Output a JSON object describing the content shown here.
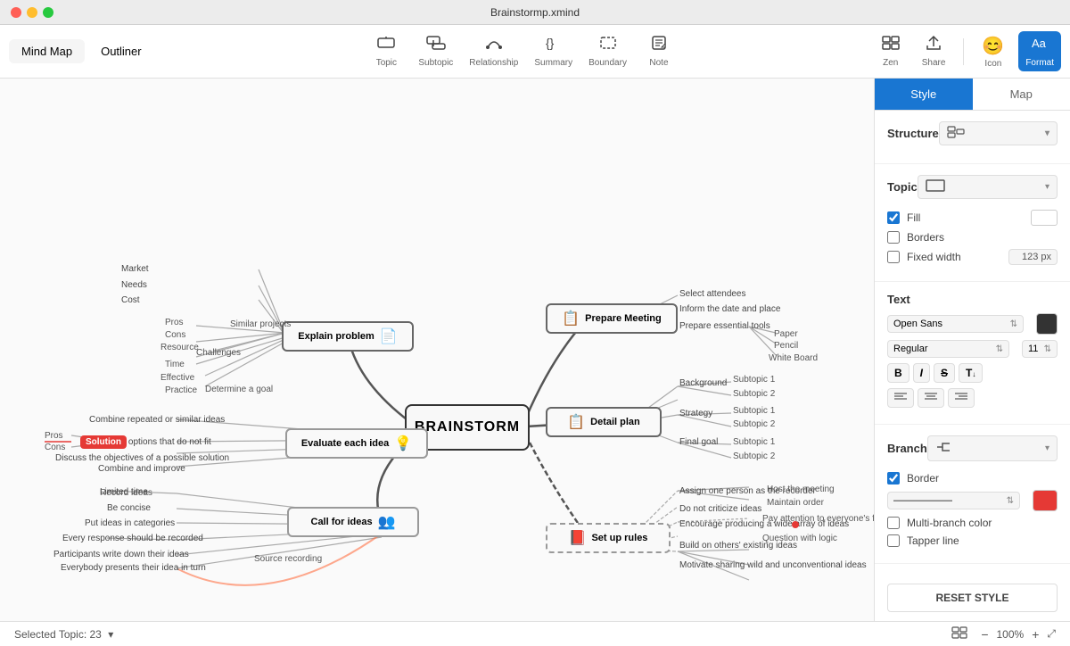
{
  "window": {
    "title": "Brainstormp.xmind"
  },
  "toolbar": {
    "tabs": [
      {
        "id": "mindmap",
        "label": "Mind Map",
        "active": true
      },
      {
        "id": "outliner",
        "label": "Outliner",
        "active": false
      }
    ],
    "tools": [
      {
        "id": "topic",
        "label": "Topic",
        "icon": "⊞"
      },
      {
        "id": "subtopic",
        "label": "Subtopic",
        "icon": "⊟"
      },
      {
        "id": "relationship",
        "label": "Relationship",
        "icon": "↩"
      },
      {
        "id": "summary",
        "label": "Summary",
        "icon": "{}"
      },
      {
        "id": "boundary",
        "label": "Boundary",
        "icon": "⬚"
      },
      {
        "id": "note",
        "label": "Note",
        "icon": "✎"
      }
    ],
    "actions": [
      {
        "id": "zen",
        "label": "Zen",
        "icon": "⛶"
      },
      {
        "id": "share",
        "label": "Share",
        "icon": "⬆"
      }
    ],
    "right_actions": [
      {
        "id": "icon",
        "label": "Icon"
      },
      {
        "id": "format",
        "label": "Format"
      }
    ]
  },
  "status_bar": {
    "selected": "Selected Topic: 23",
    "zoom": "100%",
    "zoom_minus": "−",
    "zoom_plus": "+"
  },
  "right_panel": {
    "tabs": [
      {
        "id": "style",
        "label": "Style",
        "active": true
      },
      {
        "id": "map",
        "label": "Map",
        "active": false
      }
    ],
    "structure": {
      "label": "Structure",
      "value": "Mind Map",
      "icon": "⊟⊟"
    },
    "topic": {
      "label": "Topic",
      "shape": "Rectangle",
      "fill_checked": true,
      "fill_label": "Fill",
      "borders_checked": false,
      "borders_label": "Borders",
      "fixed_width_checked": false,
      "fixed_width_label": "Fixed width",
      "fixed_width_value": "123 px"
    },
    "text": {
      "label": "Text",
      "font": "Open Sans",
      "weight": "Regular",
      "size": "11",
      "color": "#333333",
      "bold": "B",
      "italic": "I",
      "strikethrough": "S",
      "more": "T↓",
      "align_left": "≡",
      "align_center": "≡",
      "align_right": "≡"
    },
    "branch": {
      "label": "Branch",
      "style": "L-shape",
      "border_checked": true,
      "border_label": "Border",
      "line_style": "—————",
      "color": "#e53935",
      "multi_branch_checked": false,
      "multi_branch_label": "Multi-branch color",
      "tapper_line_checked": false,
      "tapper_line_label": "Tapper line"
    },
    "reset_label": "RESET STYLE"
  },
  "mindmap": {
    "center": "BRAINSTORM",
    "nodes": [
      {
        "id": "explain",
        "label": "Explain problem",
        "icon": "📄"
      },
      {
        "id": "evaluate",
        "label": "Evaluate each idea",
        "icon": "💡"
      },
      {
        "id": "callforideas",
        "label": "Call for ideas",
        "icon": "👥"
      },
      {
        "id": "prepare",
        "label": "Prepare Meeting",
        "icon": "📋"
      },
      {
        "id": "detail",
        "label": "Detail plan",
        "icon": "📋"
      },
      {
        "id": "setuprules",
        "label": "Set up rules",
        "icon": "📕"
      }
    ],
    "subnodes": {
      "explain": [
        "Market",
        "Needs",
        "Cost",
        "Pros",
        "Cons",
        "Resource",
        "Challenges",
        "Time",
        "Effective",
        "Practice"
      ],
      "prepare": [
        "Select attendees",
        "Inform the date and place",
        "Prepare essential tools",
        "Paper",
        "Pencil",
        "White Board"
      ],
      "detail": [
        "Background",
        "Subtopic 1",
        "Subtopic 2",
        "Strategy",
        "Subtopic 1",
        "Subtopic 2",
        "Final goal",
        "Subtopic 1",
        "Subtopic 2"
      ],
      "evaluate": [
        "Combine repeated or similar ideas",
        "Eliminate options that do not fit",
        "Discuss the objectives of a possible solution",
        "Combine and improve"
      ],
      "callforideas": [
        "Limited time",
        "Be concise",
        "Put ideas in categories",
        "Every response should be recorded",
        "Participants write down their ideas",
        "Everybody presents their idea in turn",
        "Record ideas",
        "Source recording"
      ],
      "setuprules": [
        "Assign one person as the recorder",
        "Do not criticize ideas",
        "Encourage producing a wide array of ideas",
        "Build on others' existing ideas",
        "Motivate sharing wild and unconventional ideas",
        "Host the meeting",
        "Maintain order",
        "Pay attention to everyone's focus",
        "Question with logic"
      ]
    },
    "solution_label": "Solution",
    "pros_label": "Pros",
    "cons_label": "Cons",
    "similar_projects": "Similar projects",
    "determine_goal": "Determine a goal"
  }
}
